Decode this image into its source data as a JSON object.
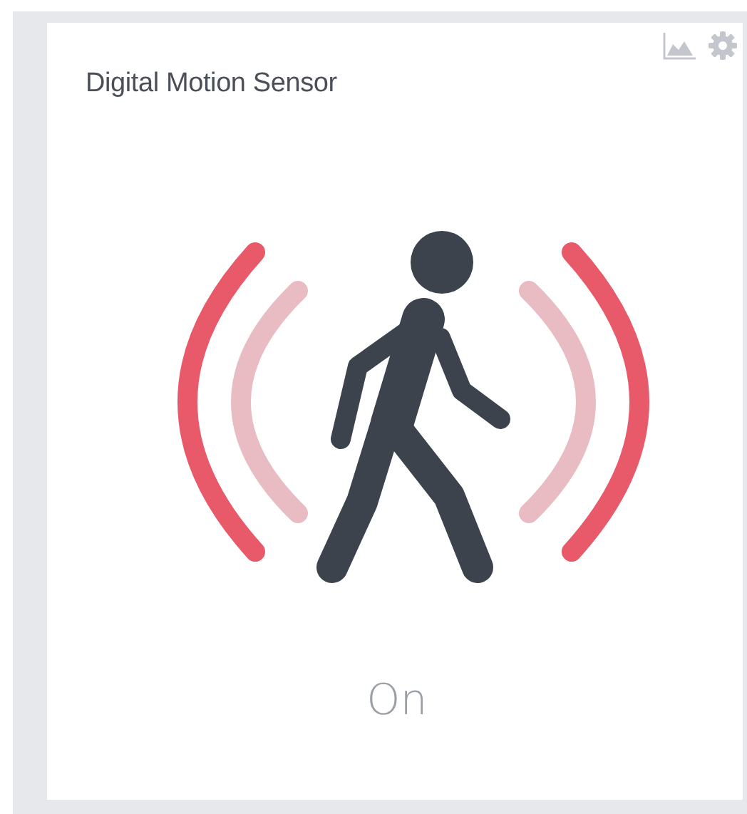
{
  "tile": {
    "title": "Digital Motion Sensor",
    "motion_detected": true,
    "status": "On"
  }
}
